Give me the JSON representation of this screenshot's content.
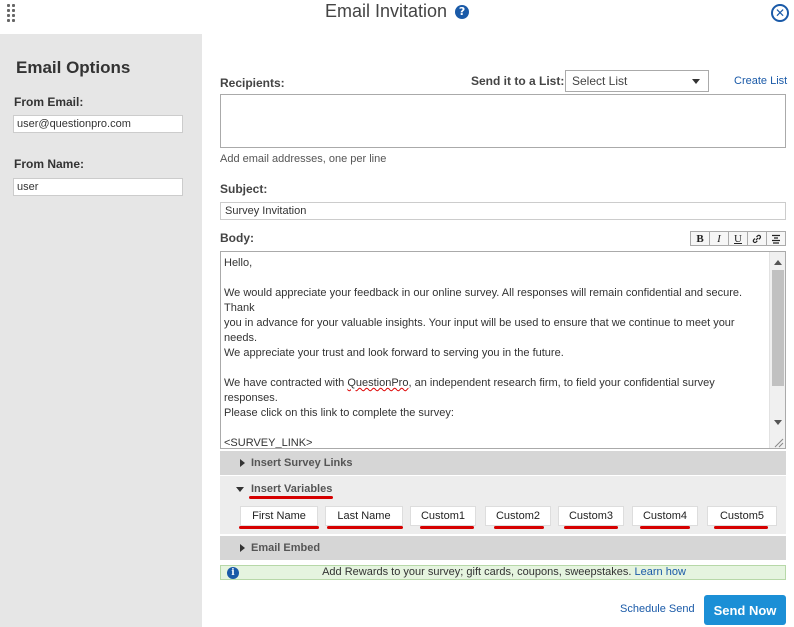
{
  "header": {
    "title": "Email Invitation",
    "help_icon": "help-icon",
    "close_icon": "close-icon"
  },
  "sidebar": {
    "title": "Email Options",
    "from_email_label": "From Email:",
    "from_email_value": "user@questionpro.com",
    "from_name_label": "From Name:",
    "from_name_value": "user"
  },
  "recipients": {
    "label": "Recipients:",
    "send_to_list_label": "Send it to a List:",
    "select_value": "Select List",
    "create_list": "Create List",
    "hint": "Add email addresses, one per line"
  },
  "subject": {
    "label": "Subject:",
    "value": "Survey Invitation"
  },
  "body": {
    "label": "Body:",
    "toolbar": [
      "B",
      "I",
      "U",
      "link-icon",
      "align-center-icon"
    ],
    "lines": [
      "Hello,",
      "",
      "We would appreciate your feedback in our online survey.  All responses will remain confidential and secure.  Thank",
      "you in advance for your valuable insights.  Your input will be used to ensure that we continue to meet your needs.",
      "We appreciate your trust and look forward to serving you in the future.",
      "",
      "We have contracted with ",
      "QuestionPro",
      ", an independent research firm, to field your confidential survey responses.",
      "Please click on this link to complete the survey:",
      "",
      "<SURVEY_LINK>"
    ]
  },
  "sections": {
    "survey_links": "Insert Survey Links",
    "variables": "Insert Variables",
    "email_embed": "Email Embed"
  },
  "variables": [
    "First Name",
    "Last Name",
    "Custom1",
    "Custom2",
    "Custom3",
    "Custom4",
    "Custom5"
  ],
  "rewards": {
    "text": "Add Rewards to your survey; gift cards, coupons, sweepstakes. ",
    "link": "Learn how"
  },
  "footer": {
    "schedule_send": "Schedule Send",
    "send_now": "Send Now"
  },
  "colors": {
    "accent": "#1b8fd6",
    "link": "#1a5aa8",
    "annotation_red": "#d60000"
  }
}
